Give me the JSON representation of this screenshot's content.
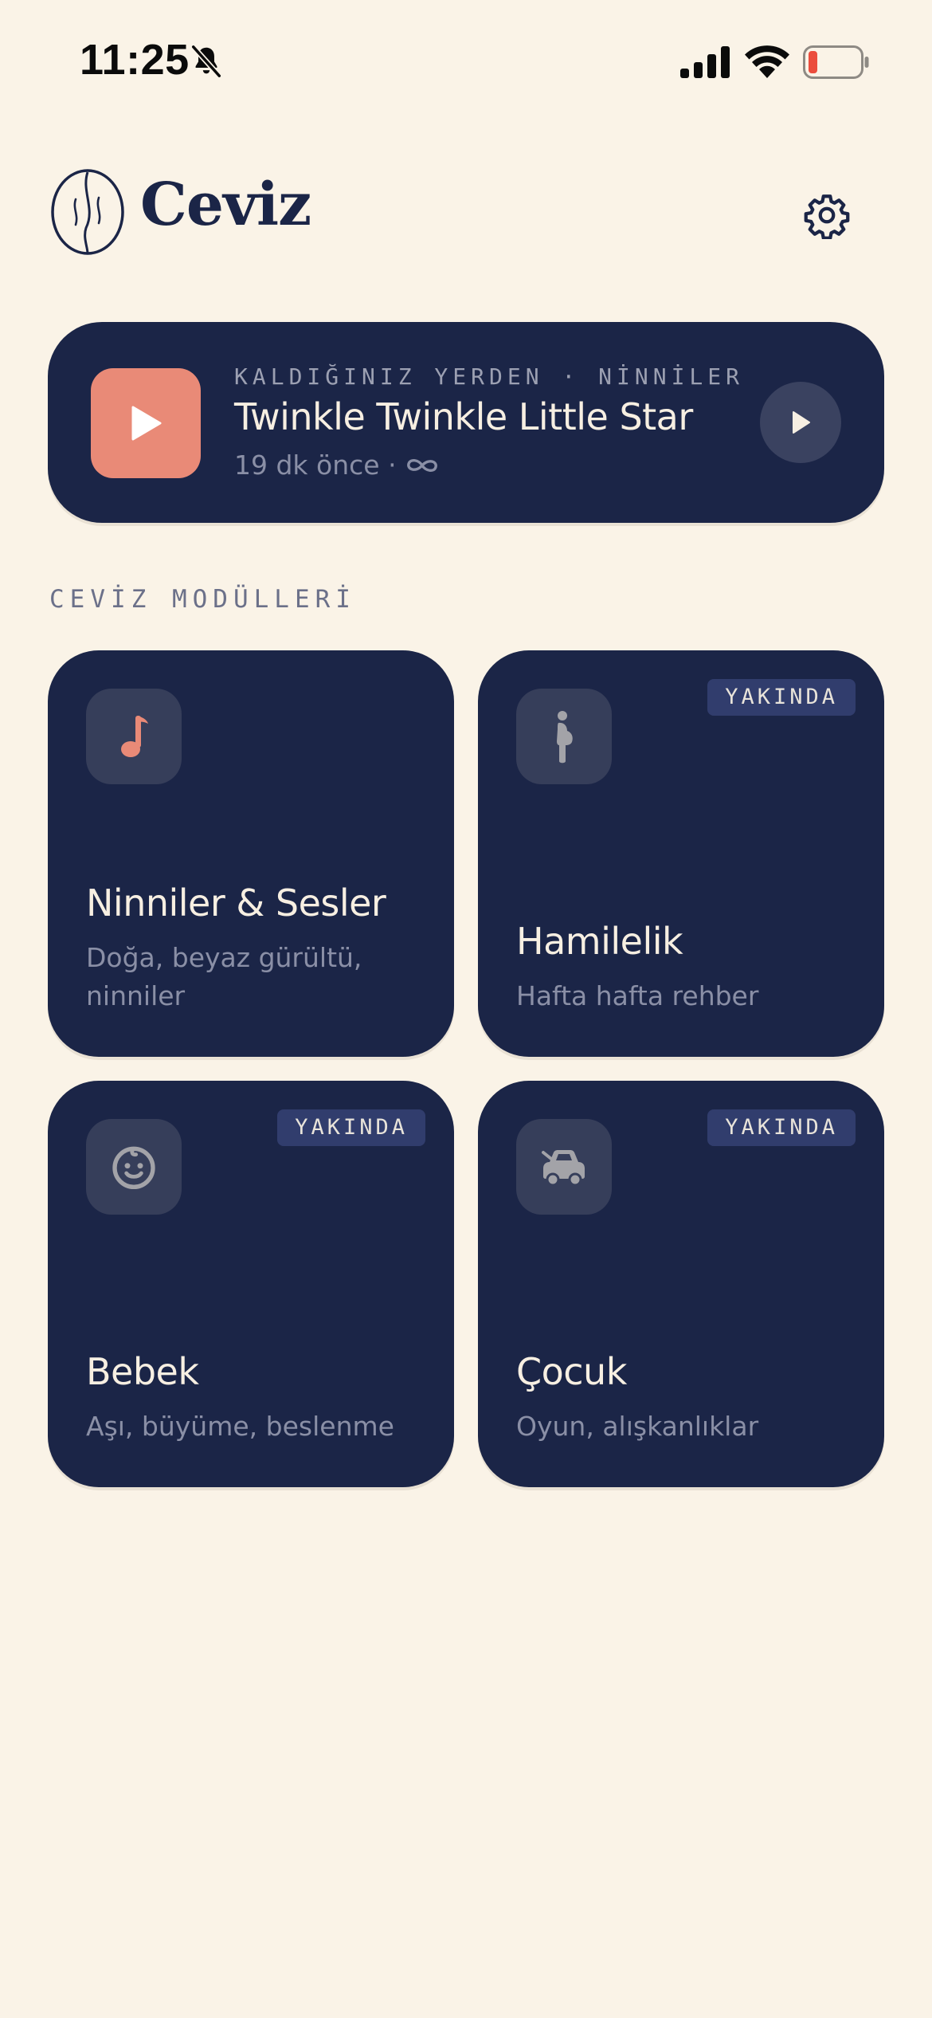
{
  "status_bar": {
    "time": "11:25",
    "icons": [
      "bell-off-icon",
      "signal-icon",
      "wifi-icon",
      "battery-low-icon"
    ]
  },
  "header": {
    "app_name": "Ceviz",
    "logo": "walnut-logo",
    "settings_icon": "gear-icon"
  },
  "continue_listening": {
    "eyebrow": "KALDIĞINIZ YERDEN · NİNNİLER",
    "title": "Twinkle Twinkle Little Star",
    "meta": "19 dk önce ·",
    "loop_icon": "infinity-icon",
    "thumb_icon": "play-icon",
    "action_icon": "play-icon"
  },
  "section": {
    "title": "CEVİZ MODÜLLERİ"
  },
  "modules": [
    {
      "title": "Ninniler & Sesler",
      "description": "Doğa, beyaz gürültü, ninniler",
      "icon": "music-note-icon",
      "badge": null
    },
    {
      "title": "Hamilelik",
      "description": "Hafta hafta rehber",
      "icon": "pregnant-woman-icon",
      "badge": "YAKINDA"
    },
    {
      "title": "Bebek",
      "description": "Aşı, büyüme, beslenme",
      "icon": "baby-face-icon",
      "badge": "YAKINDA"
    },
    {
      "title": "Çocuk",
      "description": "Oyun, alışkanlıklar",
      "icon": "toy-car-icon",
      "badge": "YAKINDA"
    }
  ],
  "colors": {
    "background": "#FAF3E7",
    "card": "#1B2547",
    "accent": "#E98A77",
    "text_light": "#F7EFE2",
    "text_muted": "#8A8FA6",
    "badge_bg": "#313D6D"
  }
}
